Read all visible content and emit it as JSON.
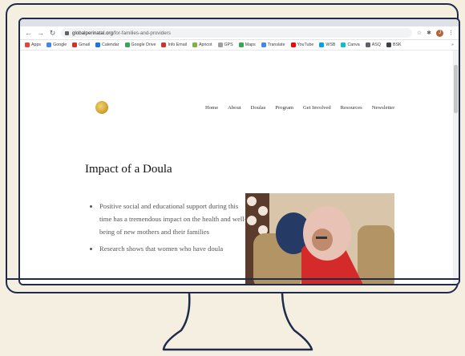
{
  "browser": {
    "url_domain": "globalperinatal.org",
    "url_path": "/for-families-and-providers",
    "profile_initial": "J",
    "bookmarks": [
      {
        "label": "Apps",
        "color": "#ea4335"
      },
      {
        "label": "Google",
        "color": "#4285f4"
      },
      {
        "label": "Gmail",
        "color": "#d93025"
      },
      {
        "label": "Calendar",
        "color": "#1a73e8"
      },
      {
        "label": "Google Drive",
        "color": "#34a853"
      },
      {
        "label": "Info Email",
        "color": "#d93025"
      },
      {
        "label": "Apricot",
        "color": "#7cb342"
      },
      {
        "label": "GPS",
        "color": "#9e9e9e"
      },
      {
        "label": "Maps",
        "color": "#34a853"
      },
      {
        "label": "Translate",
        "color": "#4285f4"
      },
      {
        "label": "YouTube",
        "color": "#ff0000"
      },
      {
        "label": "WSB",
        "color": "#00a2e8"
      },
      {
        "label": "Canva",
        "color": "#00c4cc"
      },
      {
        "label": "ASQ",
        "color": "#5f6368"
      },
      {
        "label": "BSK",
        "color": "#3c4043"
      }
    ],
    "more_label": "»"
  },
  "site": {
    "nav": [
      "Home",
      "About",
      "Doulas",
      "Program",
      "Get Involved",
      "Resources",
      "Newsletter"
    ]
  },
  "content": {
    "title": "Impact of a Doula",
    "bullets": [
      "Positive social and educational support during this time has a tremendous impact on the health and well-being of new mothers and their families",
      "Research shows that women who have doula"
    ]
  },
  "colors": {
    "frame": "#1f2b4a",
    "background": "#f4efe0"
  }
}
